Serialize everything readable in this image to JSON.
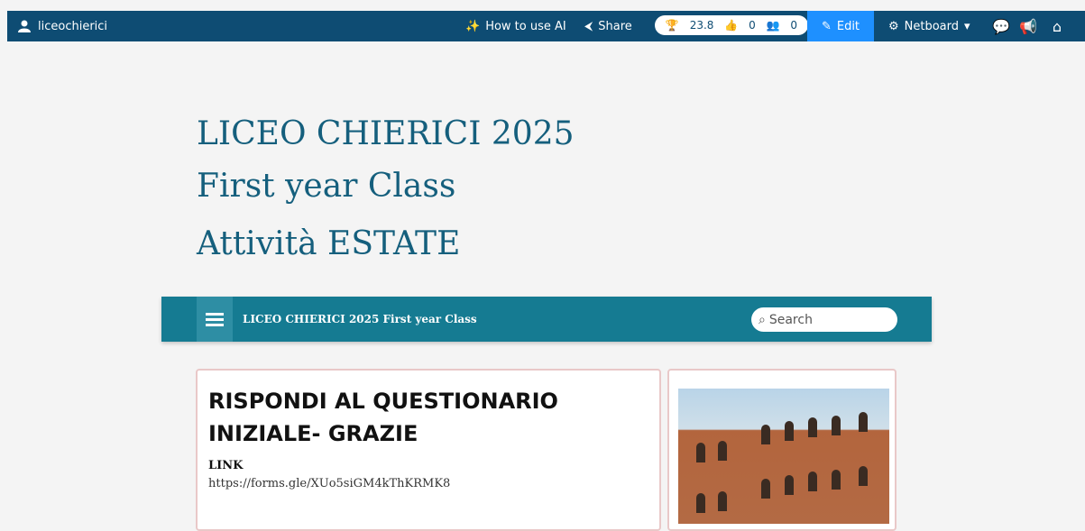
{
  "topbar": {
    "username": "liceochierici",
    "how_to_ai": "How to use AI",
    "share": "Share",
    "score": "23.8",
    "likes": "0",
    "members": "0",
    "edit": "Edit",
    "netboard": "Netboard",
    "colors": {
      "bar": "#0e4c73",
      "edit": "#1e90ff"
    }
  },
  "page": {
    "title_line1": "LICEO CHIERICI 2025",
    "title_line2": "First year Class",
    "title_line3": "Attività ESTATE"
  },
  "nav": {
    "title": "LICEO CHIERICI 2025 First year Class",
    "search_placeholder": "Search"
  },
  "post": {
    "heading": "RISPONDI AL QUESTIONARIO INIZIALE- GRAZIE",
    "label": "LINK",
    "url": "https://forms.gle/XUo5siGM4kThKRMK8"
  }
}
